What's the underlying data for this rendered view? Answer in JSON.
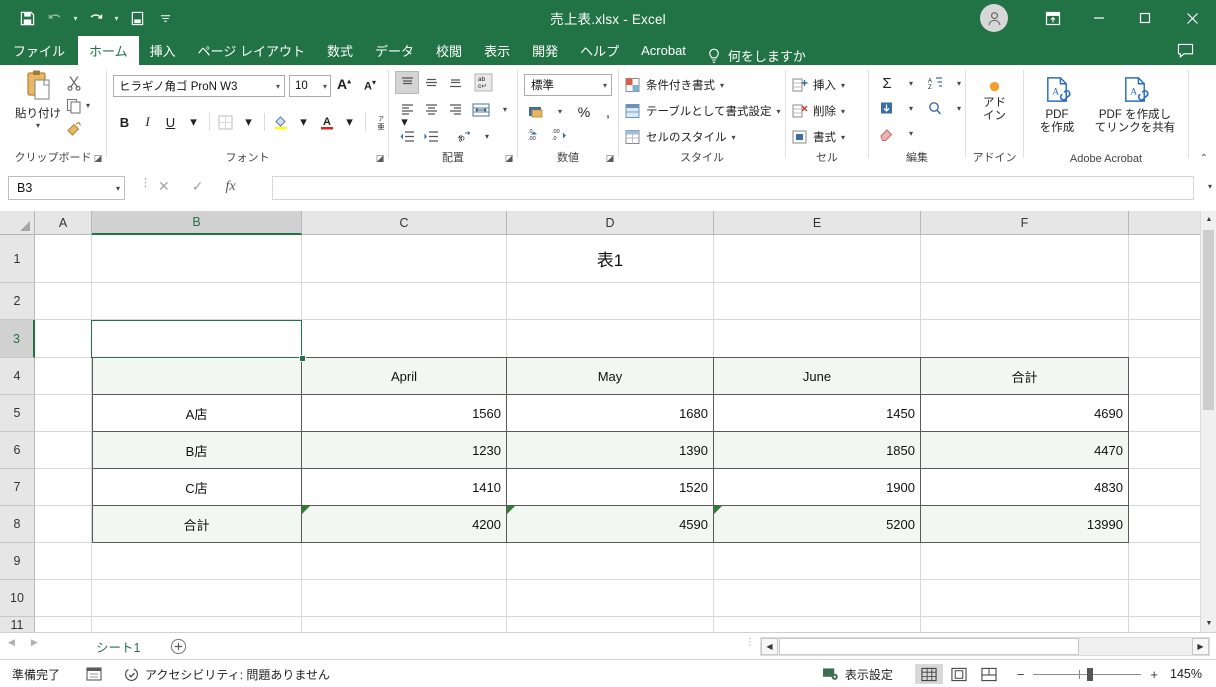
{
  "window": {
    "title": "売上表.xlsx  -  Excel",
    "quick_access": [
      "save-icon",
      "undo-icon",
      "redo-icon",
      "quick-print-icon",
      "customize-icon"
    ],
    "controls": [
      "ribbon-display-options",
      "minimize",
      "restore",
      "close"
    ]
  },
  "tabs": [
    {
      "label": "ファイル",
      "active": false
    },
    {
      "label": "ホーム",
      "active": true
    },
    {
      "label": "挿入",
      "active": false
    },
    {
      "label": "ページ レイアウト",
      "active": false
    },
    {
      "label": "数式",
      "active": false
    },
    {
      "label": "データ",
      "active": false
    },
    {
      "label": "校閲",
      "active": false
    },
    {
      "label": "表示",
      "active": false
    },
    {
      "label": "開発",
      "active": false
    },
    {
      "label": "ヘルプ",
      "active": false
    },
    {
      "label": "Acrobat",
      "active": false
    }
  ],
  "tell_me": "何をしますか",
  "ribbon": {
    "clipboard": {
      "group_label": "クリップボード",
      "paste_label": "貼り付け",
      "cut": "cut-icon",
      "copy": "copy-icon",
      "format_painter": "format-painter-icon"
    },
    "font": {
      "group_label": "フォント",
      "font_name": "ヒラギノ角ゴ ProN W3",
      "font_size": "10",
      "grow_font": "A",
      "shrink_font": "A",
      "bold": "B",
      "italic": "I",
      "underline": "U",
      "borders": "borders-icon",
      "fill_color": "fill-color-icon",
      "font_color": "font-color-icon",
      "phonetic": "phonetic-guide-icon"
    },
    "alignment": {
      "group_label": "配置",
      "top_align": "align-top-icon",
      "middle_align": "align-middle-icon",
      "bottom_align": "align-bottom-icon",
      "orientation": "orientation-icon",
      "align_left": "align-left-icon",
      "align_center": "align-center-icon",
      "align_right": "align-right-icon",
      "merge_center": "merge-center-icon",
      "decrease_indent": "decrease-indent-icon",
      "increase_indent": "increase-indent-icon",
      "wrap_text": "wrap-text-icon"
    },
    "number": {
      "group_label": "数値",
      "format": "標準",
      "accounting": "accounting-format-icon",
      "percent": "%",
      "comma": ",",
      "increase_decimal": "increase-decimal-icon",
      "decrease_decimal": "decrease-decimal-icon"
    },
    "styles": {
      "group_label": "スタイル",
      "items": [
        {
          "label": "条件付き書式",
          "icon": "conditional-formatting-icon"
        },
        {
          "label": "テーブルとして書式設定",
          "icon": "format-as-table-icon"
        },
        {
          "label": "セルのスタイル",
          "icon": "cell-styles-icon"
        }
      ]
    },
    "cells": {
      "group_label": "セル",
      "items": [
        {
          "label": "挿入",
          "icon": "insert-cells-icon"
        },
        {
          "label": "削除",
          "icon": "delete-cells-icon"
        },
        {
          "label": "書式",
          "icon": "format-cells-icon"
        }
      ]
    },
    "editing": {
      "group_label": "編集",
      "autosum": "Σ",
      "fill": "fill-down-icon",
      "clear": "clear-icon",
      "sort_filter": "sort-filter-icon",
      "find_select": "find-select-icon"
    },
    "addins": {
      "group_label": "アドイン",
      "button_line1": "アド",
      "button_line2": "イン"
    },
    "acrobat": {
      "group_label": "Adobe Acrobat",
      "create_pdf_line1": "PDF",
      "create_pdf_line2": "を作成",
      "share_link_line1": "PDF を作成し",
      "share_link_line2": "てリンクを共有"
    },
    "collapse": "collapse-ribbon-icon"
  },
  "formula_bar": {
    "name_box": "B3",
    "cancel": "cancel-icon",
    "enter": "enter-icon",
    "insert_function": "fx",
    "formula_value": ""
  },
  "grid": {
    "columns": [
      "A",
      "B",
      "C",
      "D",
      "E",
      "F"
    ],
    "selected_column": "B",
    "rows": [
      "1",
      "2",
      "3",
      "4",
      "5",
      "6",
      "7",
      "8",
      "9",
      "10",
      "11"
    ],
    "selected_row": "3",
    "active_cell": "B3",
    "cells": [
      {
        "ref": "E1",
        "text": "表1",
        "align": "center",
        "shaded": false
      },
      {
        "ref": "C4",
        "text": "April",
        "align": "center",
        "shaded": true
      },
      {
        "ref": "D4",
        "text": "May",
        "align": "center",
        "shaded": true
      },
      {
        "ref": "E4",
        "text": "June",
        "align": "center",
        "shaded": true
      },
      {
        "ref": "F4",
        "text": "合計",
        "align": "center",
        "shaded": true
      },
      {
        "ref": "B4",
        "text": "",
        "align": "center",
        "shaded": true
      },
      {
        "ref": "B5",
        "text": "A店",
        "align": "center",
        "shaded": false
      },
      {
        "ref": "C5",
        "text": "1560",
        "align": "right",
        "shaded": false
      },
      {
        "ref": "D5",
        "text": "1680",
        "align": "right",
        "shaded": false
      },
      {
        "ref": "E5",
        "text": "1450",
        "align": "right",
        "shaded": false
      },
      {
        "ref": "F5",
        "text": "4690",
        "align": "right",
        "shaded": false
      },
      {
        "ref": "B6",
        "text": "B店",
        "align": "center",
        "shaded": true
      },
      {
        "ref": "C6",
        "text": "1230",
        "align": "right",
        "shaded": true
      },
      {
        "ref": "D6",
        "text": "1390",
        "align": "right",
        "shaded": true
      },
      {
        "ref": "E6",
        "text": "1850",
        "align": "right",
        "shaded": true
      },
      {
        "ref": "F6",
        "text": "4470",
        "align": "right",
        "shaded": true
      },
      {
        "ref": "B7",
        "text": "C店",
        "align": "center",
        "shaded": false
      },
      {
        "ref": "C7",
        "text": "1410",
        "align": "right",
        "shaded": false
      },
      {
        "ref": "D7",
        "text": "1520",
        "align": "right",
        "shaded": false
      },
      {
        "ref": "E7",
        "text": "1900",
        "align": "right",
        "shaded": false
      },
      {
        "ref": "F7",
        "text": "4830",
        "align": "right",
        "shaded": false
      },
      {
        "ref": "B8",
        "text": "合計",
        "align": "center",
        "shaded": true
      },
      {
        "ref": "C8",
        "text": "4200",
        "align": "right",
        "shaded": true
      },
      {
        "ref": "D8",
        "text": "4590",
        "align": "right",
        "shaded": true
      },
      {
        "ref": "E8",
        "text": "5200",
        "align": "right",
        "shaded": true
      },
      {
        "ref": "F8",
        "text": "13990",
        "align": "right",
        "shaded": true
      }
    ],
    "comment_markers": [
      "C8",
      "D8",
      "E8"
    ]
  },
  "table_data": {
    "title": "表1",
    "headers": [
      "",
      "April",
      "May",
      "June",
      "合計"
    ],
    "rows": [
      {
        "name": "A店",
        "values": [
          1560,
          1680,
          1450,
          4690
        ]
      },
      {
        "name": "B店",
        "values": [
          1230,
          1390,
          1850,
          4470
        ]
      },
      {
        "name": "C店",
        "values": [
          1410,
          1520,
          1900,
          4830
        ]
      },
      {
        "name": "合計",
        "values": [
          4200,
          4590,
          5200,
          13990
        ]
      }
    ]
  },
  "sheet_tabs": {
    "tabs": [
      "シート1"
    ],
    "active": "シート1",
    "add_label": "+"
  },
  "status_bar": {
    "state": "準備完了",
    "macro_icon": "record-macro-icon",
    "accessibility": "アクセシビリティ: 問題ありません",
    "display_settings": "表示設定",
    "view_normal": "normal-view-icon",
    "view_page_layout": "page-layout-view-icon",
    "view_page_break": "page-break-view-icon",
    "zoom_out": "−",
    "zoom_in": "+",
    "zoom_level": "145%"
  },
  "colors": {
    "excel_green": "#217346",
    "table_shade": "#f2f7f4",
    "header_gray": "#e6e6e6",
    "comment_marker": "#2e7d32"
  }
}
